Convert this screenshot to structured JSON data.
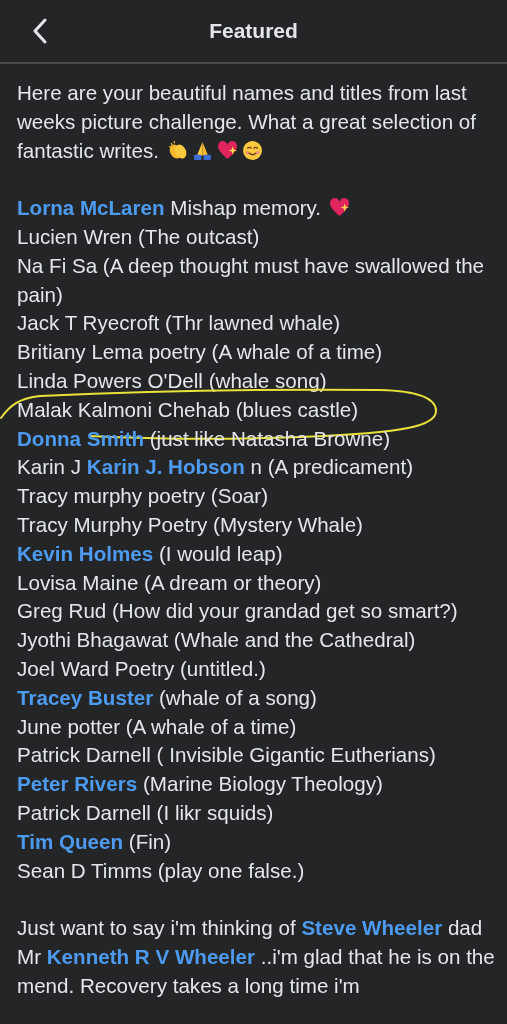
{
  "header": {
    "title": "Featured"
  },
  "paragraphs": [
    {
      "parts": [
        {
          "kind": "text",
          "text": "Here are your beautiful names and titles from last weeks picture challenge. What a great selection of fantastic writes. "
        },
        {
          "kind": "clap-emoji"
        },
        {
          "kind": "pray-emoji"
        },
        {
          "kind": "heart-emoji"
        },
        {
          "kind": "smile-emoji"
        }
      ]
    }
  ],
  "entries": [
    {
      "circled": false,
      "parts": [
        {
          "kind": "mention",
          "text": "Lorna McLaren"
        },
        {
          "kind": "text",
          "text": " Mishap memory. "
        },
        {
          "kind": "heart-emoji"
        }
      ]
    },
    {
      "circled": false,
      "parts": [
        {
          "kind": "text",
          "text": "Lucien Wren (The outcast)"
        }
      ]
    },
    {
      "circled": false,
      "parts": [
        {
          "kind": "text",
          "text": "Na Fi Sa (A deep thought must have swallowed the pain)"
        }
      ]
    },
    {
      "circled": false,
      "parts": [
        {
          "kind": "text",
          "text": "Jack T Ryecroft (Thr lawned whale)"
        }
      ]
    },
    {
      "circled": false,
      "parts": [
        {
          "kind": "text",
          "text": "Britiany Lema poetry (A whale of a time)"
        }
      ]
    },
    {
      "circled": false,
      "parts": [
        {
          "kind": "text",
          "text": "Linda Powers O'Dell (whale song)"
        }
      ]
    },
    {
      "circled": true,
      "parts": [
        {
          "kind": "text",
          "text": "Malak Kalmoni Chehab (blues castle)"
        }
      ]
    },
    {
      "circled": false,
      "parts": [
        {
          "kind": "mention",
          "text": "Donna Smith"
        },
        {
          "kind": "text",
          "text": "  (just like Natasha Browne)"
        }
      ]
    },
    {
      "circled": false,
      "parts": [
        {
          "kind": "text",
          "text": "Karin J "
        },
        {
          "kind": "mention",
          "text": "Karin J. Hobson"
        },
        {
          "kind": "text",
          "text": " n (A predicament)"
        }
      ]
    },
    {
      "circled": false,
      "parts": [
        {
          "kind": "text",
          "text": "Tracy murphy poetry (Soar)"
        }
      ]
    },
    {
      "circled": false,
      "parts": [
        {
          "kind": "text",
          "text": "Tracy Murphy Poetry (Mystery Whale)"
        }
      ]
    },
    {
      "circled": false,
      "parts": [
        {
          "kind": "mention",
          "text": "Kevin Holmes"
        },
        {
          "kind": "text",
          "text": "  (I would leap)"
        }
      ]
    },
    {
      "circled": false,
      "parts": [
        {
          "kind": "text",
          "text": "Lovisa Maine (A dream or theory)"
        }
      ]
    },
    {
      "circled": false,
      "parts": [
        {
          "kind": "text",
          "text": "Greg Rud (How did your grandad get so smart?)"
        }
      ]
    },
    {
      "circled": false,
      "parts": [
        {
          "kind": "text",
          "text": "Jyothi Bhagawat (Whale and the Cathedral)"
        }
      ]
    },
    {
      "circled": false,
      "parts": [
        {
          "kind": "text",
          "text": "Joel Ward Poetry (untitled.)"
        }
      ]
    },
    {
      "circled": false,
      "parts": [
        {
          "kind": "mention",
          "text": "Tracey Buster"
        },
        {
          "kind": "text",
          "text": "  (whale of a song)"
        }
      ]
    },
    {
      "circled": false,
      "parts": [
        {
          "kind": "text",
          "text": "June potter (A whale of a time)"
        }
      ]
    },
    {
      "circled": false,
      "parts": [
        {
          "kind": "text",
          "text": "Patrick Darnell ( Invisible Gigantic Eutherians)"
        }
      ]
    },
    {
      "circled": false,
      "parts": [
        {
          "kind": "mention",
          "text": "Peter Rivers"
        },
        {
          "kind": "text",
          "text": "  (Marine Biology Theology)"
        }
      ]
    },
    {
      "circled": false,
      "parts": [
        {
          "kind": "text",
          "text": "Patrick Darnell (I likr squids)"
        }
      ]
    },
    {
      "circled": false,
      "parts": [
        {
          "kind": "mention",
          "text": "Tim Queen"
        },
        {
          "kind": "text",
          "text": "  (Fin)"
        }
      ]
    },
    {
      "circled": false,
      "parts": [
        {
          "kind": "text",
          "text": "Sean D Timms (play one false.)"
        }
      ]
    }
  ],
  "closing": [
    {
      "parts": [
        {
          "kind": "text",
          "text": "Just want to say i'm thinking of "
        },
        {
          "kind": "mention",
          "text": "Steve Wheeler"
        },
        {
          "kind": "text",
          "text": " dad Mr "
        },
        {
          "kind": "mention",
          "text": "Kenneth R V Wheeler"
        },
        {
          "kind": "text",
          "text": " ..i'm glad that he is on the mend. Recovery takes a long time i'm"
        }
      ]
    }
  ]
}
